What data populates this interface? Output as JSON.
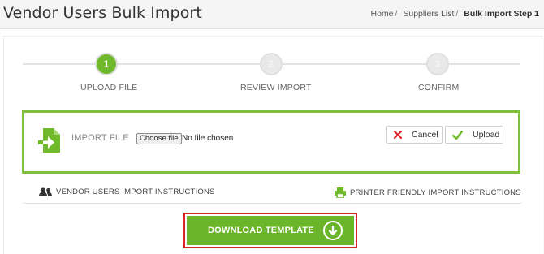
{
  "header": {
    "title": "Vendor Users Bulk Import",
    "breadcrumb": [
      "Home",
      "Suppliers List",
      "Bulk Import Step 1"
    ],
    "breadcrumb_separator": "/"
  },
  "wizard": {
    "steps": [
      {
        "number": "1",
        "label": "UPLOAD FILE",
        "state": "active"
      },
      {
        "number": "2",
        "label": "REVIEW IMPORT",
        "state": "inactive"
      },
      {
        "number": "3",
        "label": "CONFIRM",
        "state": "inactive"
      }
    ]
  },
  "import": {
    "label": "IMPORT FILE",
    "choose_button": "Choose file",
    "no_file_text": "No file chosen",
    "cancel_label": "Cancel",
    "upload_label": "Upload"
  },
  "instructions": {
    "left_label": "VENDOR USERS IMPORT INSTRUCTIONS",
    "right_label": "PRINTER FRIENDLY IMPORT INSTRUCTIONS"
  },
  "download": {
    "label": "DOWNLOAD TEMPLATE"
  },
  "icons": {
    "file_import": "file-import-icon",
    "cancel": "x-icon",
    "upload": "check-icon",
    "users": "users-icon",
    "printer": "printer-icon",
    "download": "download-arrow-icon"
  },
  "colors": {
    "accent_green": "#6fb92a",
    "highlight_red": "#d9262c",
    "cancel_red": "#d9262c"
  }
}
